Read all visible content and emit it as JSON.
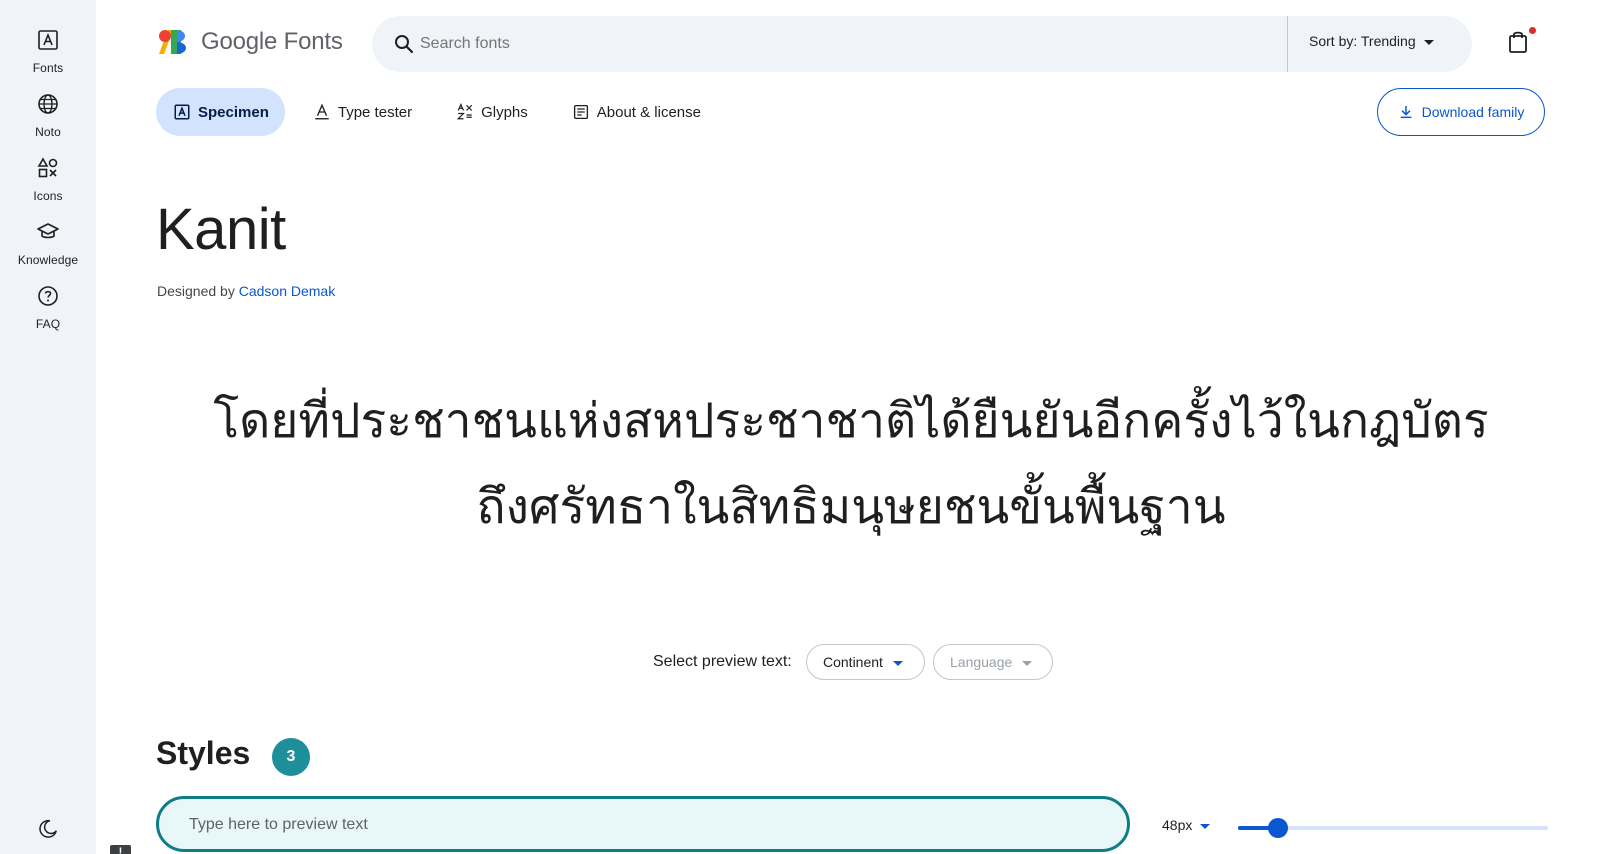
{
  "rail": {
    "items": [
      {
        "label": "Fonts",
        "icon": "font-icon"
      },
      {
        "label": "Noto",
        "icon": "globe-icon"
      },
      {
        "label": "Icons",
        "icon": "shapes-icon"
      },
      {
        "label": "Knowledge",
        "icon": "graduation-cap-icon"
      },
      {
        "label": "FAQ",
        "icon": "help-circle-icon"
      }
    ],
    "theme_icon": "moon-icon"
  },
  "header": {
    "logo_text": "Google Fonts",
    "search_placeholder": "Search fonts",
    "sort_label": "Sort by: Trending",
    "cart_icon": "shopping-bag-icon",
    "notification_color": "#d93025"
  },
  "tabs": [
    {
      "label": "Specimen",
      "icon": "specimen-icon",
      "active": true
    },
    {
      "label": "Type tester",
      "icon": "type-tester-icon",
      "active": false
    },
    {
      "label": "Glyphs",
      "icon": "glyphs-icon",
      "active": false
    },
    {
      "label": "About & license",
      "icon": "about-icon",
      "active": false
    }
  ],
  "download_label": "Download family",
  "font": {
    "name": "Kanit",
    "designed_by_prefix": "Designed by",
    "designer": "Cadson Demak"
  },
  "preview_lines": [
    "โดยที่ประชาชนแห่งสหประชาชาติได้ยืนยันอีกครั้งไว้ในกฎบัตร",
    "ถึงศรัทธาในสิทธิมนุษยชนขั้นพื้นฐาน"
  ],
  "preview_select": {
    "label": "Select preview text:",
    "continent": "Continent",
    "language": "Language"
  },
  "styles": {
    "title": "Styles",
    "count": "3",
    "input_placeholder": "Type here to preview text",
    "size_label": "48px",
    "size_slider_fraction": 0.13
  },
  "colors": {
    "accent": "#0b57d0",
    "teal": "#1d8f9b",
    "rail_bg": "#f0f4f9"
  }
}
